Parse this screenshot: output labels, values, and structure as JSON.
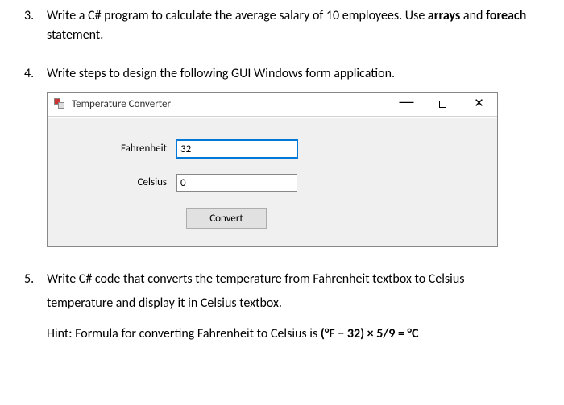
{
  "q3": {
    "num": "3.",
    "text_before_arrays": "Write a C# program to calculate the average salary of 10 employees. Use ",
    "bold_arrays": "arrays",
    "text_and": " and ",
    "bold_foreach": "foreach",
    "text_after": " statement."
  },
  "q4": {
    "num": "4.",
    "text": "Write steps to design the following GUI Windows form application."
  },
  "winform": {
    "title": "Temperature Converter",
    "fahrenheit_label": "Fahrenheit",
    "fahrenheit_value": "32",
    "celsius_label": "Celsius",
    "celsius_value": "0",
    "convert_label": "Convert",
    "min": "—",
    "close": "✕"
  },
  "q5": {
    "num": "5.",
    "line1": "Write C# code that converts the temperature from Fahrenheit textbox to Celsius",
    "line2": "temperature and display it in Celsius textbox.",
    "hint_prefix": "Hint: Formula for converting Fahrenheit to Celsius is ",
    "hint_formula": "(°F − 32) × 5/9 = °C"
  }
}
